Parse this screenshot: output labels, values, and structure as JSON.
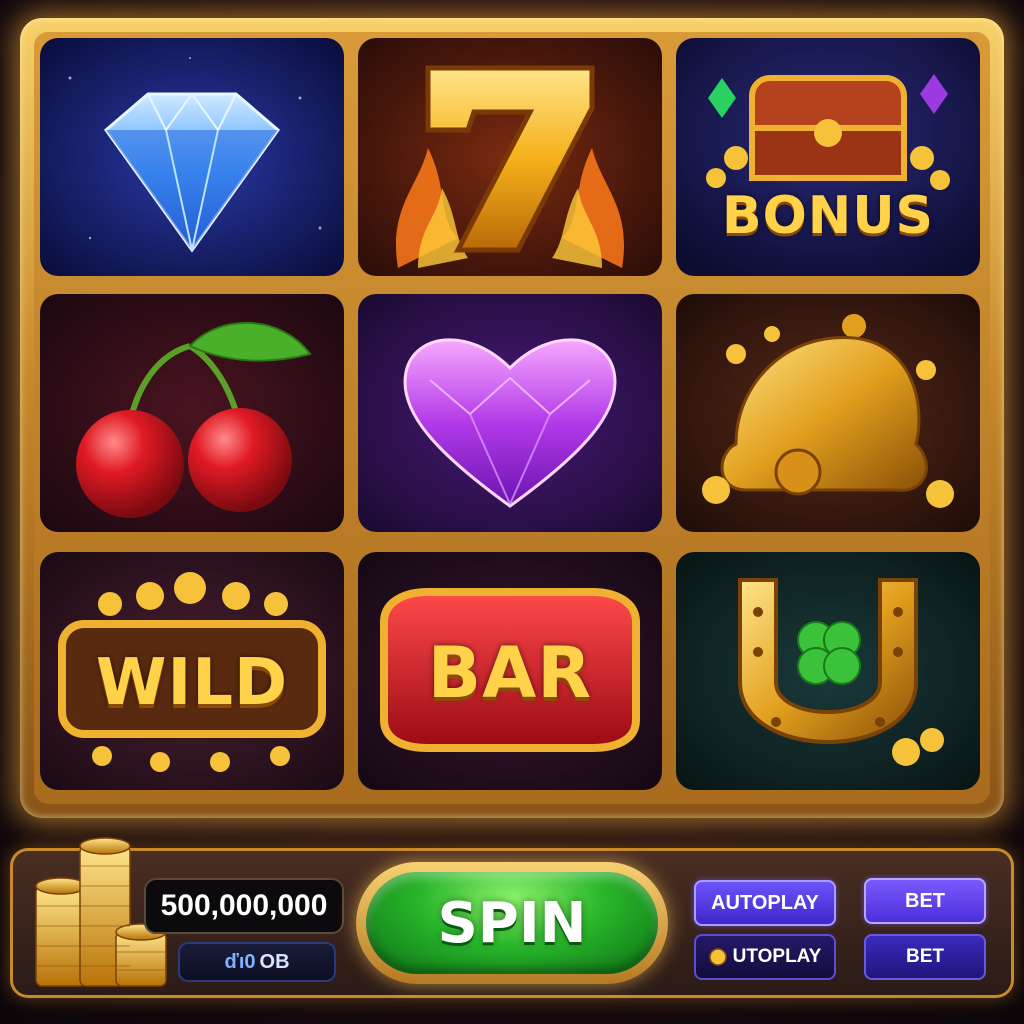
{
  "game": {
    "grid": {
      "rows": 3,
      "cols": 3,
      "symbols": [
        {
          "id": "diamond",
          "label": ""
        },
        {
          "id": "seven",
          "label": "7"
        },
        {
          "id": "bonus-chest",
          "label": "BONUS"
        },
        {
          "id": "cherries",
          "label": ""
        },
        {
          "id": "purple-heart-gem",
          "label": ""
        },
        {
          "id": "golden-bell",
          "label": ""
        },
        {
          "id": "wild",
          "label": "WILD"
        },
        {
          "id": "bar",
          "label": "BAR"
        },
        {
          "id": "horseshoe-clover",
          "label": ""
        }
      ]
    },
    "controls": {
      "balance": "500,000,000",
      "sub_balance_prefix": "ďı0",
      "sub_balance_suffix": "ОВ",
      "spin_label": "SPIN",
      "autoplay_label": "AUTOPLAY",
      "autoplay_secondary_label": "UTOPLAY",
      "bet_label": "BET",
      "bet_secondary_label": "BET"
    },
    "colors": {
      "frame_gold": "#e6a83a",
      "spin_green": "#29b52a",
      "button_purple": "#5a3ef0"
    }
  }
}
